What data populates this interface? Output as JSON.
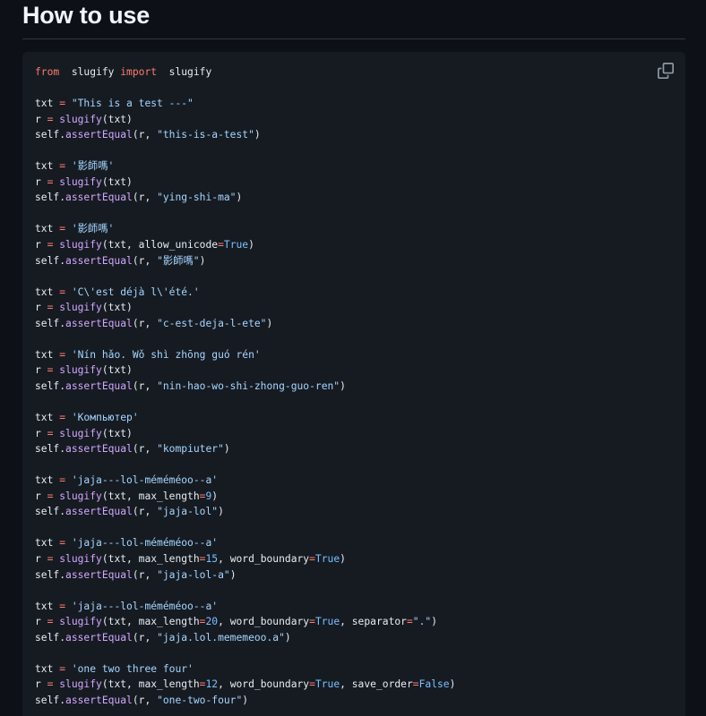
{
  "heading": "How to use",
  "copy_icon": "copy-icon",
  "colors": {
    "background": "#0d1117",
    "code_background": "#161b22",
    "keyword": "#ff7b72",
    "function": "#d2a8ff",
    "string": "#a5d6ff",
    "constant": "#79c0ff",
    "text": "#e6edf3"
  },
  "code_lines": [
    [
      [
        "kw",
        "from"
      ],
      [
        "",
        "  slugify "
      ],
      [
        "kw",
        "import"
      ],
      [
        "",
        "  slugify"
      ]
    ],
    [],
    [
      [
        "",
        "txt "
      ],
      [
        "op",
        "="
      ],
      [
        "",
        ""
      ],
      [
        "str",
        " \"This is a test ---\""
      ]
    ],
    [
      [
        "",
        "r "
      ],
      [
        "op",
        "="
      ],
      [
        "fn",
        " slugify"
      ],
      [
        "",
        "(txt)"
      ]
    ],
    [
      [
        "",
        "self."
      ],
      [
        "fn",
        "assertEqual"
      ],
      [
        "",
        "(r, "
      ],
      [
        "str",
        "\"this-is-a-test\""
      ],
      [
        "",
        ")"
      ]
    ],
    [],
    [
      [
        "",
        "txt "
      ],
      [
        "op",
        "="
      ],
      [
        "str",
        " '影師嗎'"
      ]
    ],
    [
      [
        "",
        "r "
      ],
      [
        "op",
        "="
      ],
      [
        "fn",
        " slugify"
      ],
      [
        "",
        "(txt)"
      ]
    ],
    [
      [
        "",
        "self."
      ],
      [
        "fn",
        "assertEqual"
      ],
      [
        "",
        "(r, "
      ],
      [
        "str",
        "\"ying-shi-ma\""
      ],
      [
        "",
        ")"
      ]
    ],
    [],
    [
      [
        "",
        "txt "
      ],
      [
        "op",
        "="
      ],
      [
        "str",
        " '影師嗎'"
      ]
    ],
    [
      [
        "",
        "r "
      ],
      [
        "op",
        "="
      ],
      [
        "fn",
        " slugify"
      ],
      [
        "",
        "(txt, allow_unicode"
      ],
      [
        "op",
        "="
      ],
      [
        "const",
        "True"
      ],
      [
        "",
        ")"
      ]
    ],
    [
      [
        "",
        "self."
      ],
      [
        "fn",
        "assertEqual"
      ],
      [
        "",
        "(r, "
      ],
      [
        "str",
        "\"影師嗎\""
      ],
      [
        "",
        ")"
      ]
    ],
    [],
    [
      [
        "",
        "txt "
      ],
      [
        "op",
        "="
      ],
      [
        "str",
        " 'C\\'est déjà l\\'été.'"
      ]
    ],
    [
      [
        "",
        "r "
      ],
      [
        "op",
        "="
      ],
      [
        "fn",
        " slugify"
      ],
      [
        "",
        "(txt)"
      ]
    ],
    [
      [
        "",
        "self."
      ],
      [
        "fn",
        "assertEqual"
      ],
      [
        "",
        "(r, "
      ],
      [
        "str",
        "\"c-est-deja-l-ete\""
      ],
      [
        "",
        ")"
      ]
    ],
    [],
    [
      [
        "",
        "txt "
      ],
      [
        "op",
        "="
      ],
      [
        "str",
        " 'Nín hǎo. Wǒ shì zhōng guó rén'"
      ]
    ],
    [
      [
        "",
        "r "
      ],
      [
        "op",
        "="
      ],
      [
        "fn",
        " slugify"
      ],
      [
        "",
        "(txt)"
      ]
    ],
    [
      [
        "",
        "self."
      ],
      [
        "fn",
        "assertEqual"
      ],
      [
        "",
        "(r, "
      ],
      [
        "str",
        "\"nin-hao-wo-shi-zhong-guo-ren\""
      ],
      [
        "",
        ")"
      ]
    ],
    [],
    [
      [
        "",
        "txt "
      ],
      [
        "op",
        "="
      ],
      [
        "str",
        " 'Компьютер'"
      ]
    ],
    [
      [
        "",
        "r "
      ],
      [
        "op",
        "="
      ],
      [
        "fn",
        " slugify"
      ],
      [
        "",
        "(txt)"
      ]
    ],
    [
      [
        "",
        "self."
      ],
      [
        "fn",
        "assertEqual"
      ],
      [
        "",
        "(r, "
      ],
      [
        "str",
        "\"kompiuter\""
      ],
      [
        "",
        ")"
      ]
    ],
    [],
    [
      [
        "",
        "txt "
      ],
      [
        "op",
        "="
      ],
      [
        "str",
        " 'jaja---lol-méméméoo--a'"
      ]
    ],
    [
      [
        "",
        "r "
      ],
      [
        "op",
        "="
      ],
      [
        "fn",
        " slugify"
      ],
      [
        "",
        "(txt, max_length"
      ],
      [
        "op",
        "="
      ],
      [
        "const",
        "9"
      ],
      [
        "",
        ")"
      ]
    ],
    [
      [
        "",
        "self."
      ],
      [
        "fn",
        "assertEqual"
      ],
      [
        "",
        "(r, "
      ],
      [
        "str",
        "\"jaja-lol\""
      ],
      [
        "",
        ")"
      ]
    ],
    [],
    [
      [
        "",
        "txt "
      ],
      [
        "op",
        "="
      ],
      [
        "str",
        " 'jaja---lol-méméméoo--a'"
      ]
    ],
    [
      [
        "",
        "r "
      ],
      [
        "op",
        "="
      ],
      [
        "fn",
        " slugify"
      ],
      [
        "",
        "(txt, max_length"
      ],
      [
        "op",
        "="
      ],
      [
        "const",
        "15"
      ],
      [
        "",
        ", word_boundary"
      ],
      [
        "op",
        "="
      ],
      [
        "const",
        "True"
      ],
      [
        "",
        ")"
      ]
    ],
    [
      [
        "",
        "self."
      ],
      [
        "fn",
        "assertEqual"
      ],
      [
        "",
        "(r, "
      ],
      [
        "str",
        "\"jaja-lol-a\""
      ],
      [
        "",
        ")"
      ]
    ],
    [],
    [
      [
        "",
        "txt "
      ],
      [
        "op",
        "="
      ],
      [
        "str",
        " 'jaja---lol-méméméoo--a'"
      ]
    ],
    [
      [
        "",
        "r "
      ],
      [
        "op",
        "="
      ],
      [
        "fn",
        " slugify"
      ],
      [
        "",
        "(txt, max_length"
      ],
      [
        "op",
        "="
      ],
      [
        "const",
        "20"
      ],
      [
        "",
        ", word_boundary"
      ],
      [
        "op",
        "="
      ],
      [
        "const",
        "True"
      ],
      [
        "",
        ", separator"
      ],
      [
        "op",
        "="
      ],
      [
        "str",
        "\".\""
      ],
      [
        "",
        ")"
      ]
    ],
    [
      [
        "",
        "self."
      ],
      [
        "fn",
        "assertEqual"
      ],
      [
        "",
        "(r, "
      ],
      [
        "str",
        "\"jaja.lol.mememeoo.a\""
      ],
      [
        "",
        ")"
      ]
    ],
    [],
    [
      [
        "",
        "txt "
      ],
      [
        "op",
        "="
      ],
      [
        "str",
        " 'one two three four'"
      ]
    ],
    [
      [
        "",
        "r "
      ],
      [
        "op",
        "="
      ],
      [
        "fn",
        " slugify"
      ],
      [
        "",
        "(txt, max_length"
      ],
      [
        "op",
        "="
      ],
      [
        "const",
        "12"
      ],
      [
        "",
        ", word_boundary"
      ],
      [
        "op",
        "="
      ],
      [
        "const",
        "True"
      ],
      [
        "",
        ", save_order"
      ],
      [
        "op",
        "="
      ],
      [
        "const",
        "False"
      ],
      [
        "",
        ")"
      ]
    ],
    [
      [
        "",
        "self."
      ],
      [
        "fn",
        "assertEqual"
      ],
      [
        "",
        "(r, "
      ],
      [
        "str",
        "\"one-two-four\""
      ],
      [
        "",
        ")"
      ]
    ]
  ]
}
